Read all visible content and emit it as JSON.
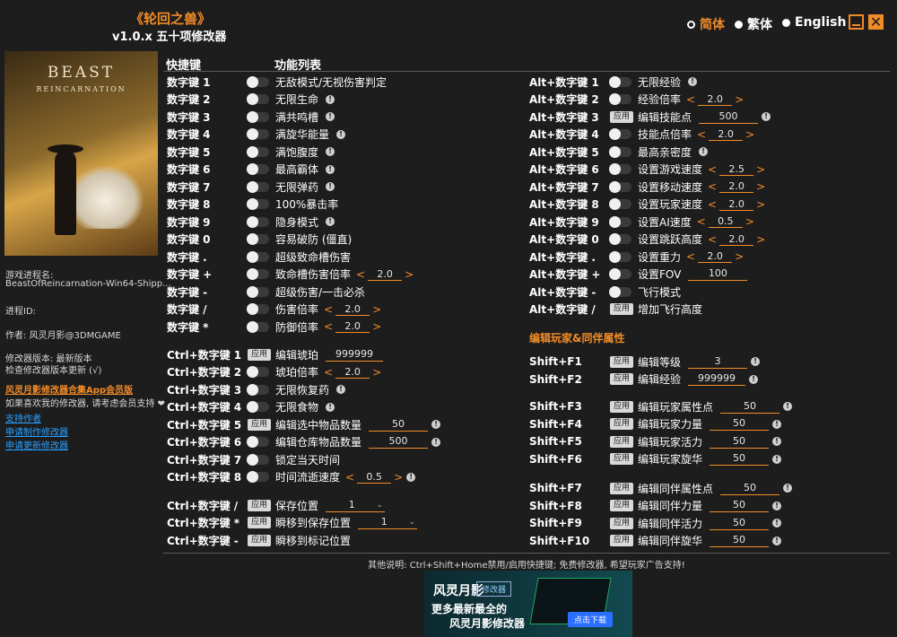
{
  "app": {
    "title": "《轮回之兽》",
    "subtitle": "v1.0.x 五十项修改器"
  },
  "languages": [
    {
      "label": "简体",
      "selected": true
    },
    {
      "label": "繁体",
      "selected": false
    },
    {
      "label": "English",
      "selected": false
    }
  ],
  "cover": {
    "title": "BEAST",
    "subtitle": "REINCARNATION"
  },
  "sidebar": {
    "process_label": "游戏进程名:",
    "process_value": "BeastOfReincarnation-Win64-Shipp...",
    "pid_label": "进程ID:",
    "author": "作者: 风灵月影@3DMGAME",
    "version": "修改器版本: 最新版本",
    "check_update": "检查修改器版本更新 (√)",
    "vip_link": "风灵月影修改器合集App会员版",
    "support_text": "如果喜欢我的修改器, 请考虑会员支持 ❤",
    "support_author": "支持作者",
    "request_make": "申请制作修改器",
    "request_update": "申请更新修改器"
  },
  "headers": {
    "hotkey": "快捷键",
    "features": "功能列表"
  },
  "left_rows": [
    {
      "key": "数字键 1",
      "type": "toggle",
      "label": "无敌模式/无视伤害判定"
    },
    {
      "key": "数字键 2",
      "type": "toggle",
      "label": "无限生命",
      "info": true
    },
    {
      "key": "数字键 3",
      "type": "toggle",
      "label": "满共鸣槽",
      "info": true
    },
    {
      "key": "数字键 4",
      "type": "toggle",
      "label": "满旋华能量",
      "info": true
    },
    {
      "key": "数字键 5",
      "type": "toggle",
      "label": "满饱腹度",
      "info": true
    },
    {
      "key": "数字键 6",
      "type": "toggle",
      "label": "最高霸体",
      "info": true
    },
    {
      "key": "数字键 7",
      "type": "toggle",
      "label": "无限弹药",
      "info": true
    },
    {
      "key": "数字键 8",
      "type": "toggle",
      "label": "100%暴击率"
    },
    {
      "key": "数字键 9",
      "type": "toggle",
      "label": "隐身模式",
      "info": true
    },
    {
      "key": "数字键 0",
      "type": "toggle",
      "label": "容易破防 (僵直)"
    },
    {
      "key": "数字键 .",
      "type": "toggle",
      "label": "超级致命槽伤害"
    },
    {
      "key": "数字键 +",
      "type": "toggle",
      "label": "致命槽伤害倍率",
      "stepper": "2.0"
    },
    {
      "key": "数字键 -",
      "type": "toggle",
      "label": "超级伤害/一击必杀"
    },
    {
      "key": "数字键 /",
      "type": "toggle",
      "label": "伤害倍率",
      "stepper": "2.0"
    },
    {
      "key": "数字键 *",
      "type": "toggle",
      "label": "防御倍率",
      "stepper": "2.0"
    },
    {
      "key": "Ctrl+数字键 1",
      "type": "apply",
      "label": "编辑琥珀",
      "field": "999999"
    },
    {
      "key": "Ctrl+数字键 2",
      "type": "toggle",
      "label": "琥珀倍率",
      "stepper": "2.0"
    },
    {
      "key": "Ctrl+数字键 3",
      "type": "toggle",
      "label": "无限恢复药",
      "info": true
    },
    {
      "key": "Ctrl+数字键 4",
      "type": "toggle",
      "label": "无限食物",
      "info": true
    },
    {
      "key": "Ctrl+数字键 5",
      "type": "apply",
      "label": "编辑选中物品数量",
      "field": "50",
      "info": true
    },
    {
      "key": "Ctrl+数字键 6",
      "type": "toggle",
      "label": "编辑仓库物品数量",
      "field": "500",
      "info": true
    },
    {
      "key": "Ctrl+数字键 7",
      "type": "toggle",
      "label": "锁定当天时间"
    },
    {
      "key": "Ctrl+数字键 8",
      "type": "toggle",
      "label": "时间流逝速度",
      "stepper": "0.5",
      "info": true
    },
    {
      "key": "Ctrl+数字键 /",
      "type": "apply",
      "label": "保存位置",
      "select": "1"
    },
    {
      "key": "Ctrl+数字键 *",
      "type": "apply",
      "label": "瞬移到保存位置",
      "select": "1"
    },
    {
      "key": "Ctrl+数字键 -",
      "type": "apply",
      "label": "瞬移到标记位置"
    }
  ],
  "right_rows": [
    {
      "key": "Alt+数字键 1",
      "type": "toggle",
      "label": "无限经验",
      "info": true
    },
    {
      "key": "Alt+数字键 2",
      "type": "toggle",
      "label": "经验倍率",
      "stepper": "2.0"
    },
    {
      "key": "Alt+数字键 3",
      "type": "apply",
      "label": "编辑技能点",
      "field": "500",
      "info": true
    },
    {
      "key": "Alt+数字键 4",
      "type": "toggle",
      "label": "技能点倍率",
      "stepper": "2.0"
    },
    {
      "key": "Alt+数字键 5",
      "type": "toggle",
      "label": "最高亲密度",
      "info": true
    },
    {
      "key": "Alt+数字键 6",
      "type": "toggle",
      "label": "设置游戏速度",
      "stepper": "2.5"
    },
    {
      "key": "Alt+数字键 7",
      "type": "toggle",
      "label": "设置移动速度",
      "stepper": "2.0"
    },
    {
      "key": "Alt+数字键 8",
      "type": "toggle",
      "label": "设置玩家速度",
      "stepper": "2.0"
    },
    {
      "key": "Alt+数字键 9",
      "type": "toggle",
      "label": "设置AI速度",
      "stepper": "0.5"
    },
    {
      "key": "Alt+数字键 0",
      "type": "toggle",
      "label": "设置跳跃高度",
      "stepper": "2.0"
    },
    {
      "key": "Alt+数字键 .",
      "type": "toggle",
      "label": "设置重力",
      "stepper": "2.0"
    },
    {
      "key": "Alt+数字键 +",
      "type": "toggle",
      "label": "设置FOV",
      "field": "100"
    },
    {
      "key": "Alt+数字键 -",
      "type": "toggle",
      "label": "飞行模式"
    },
    {
      "key": "Alt+数字键 /",
      "type": "apply",
      "label": "增加飞行高度"
    },
    {
      "key": "Shift+F1",
      "type": "apply",
      "label": "编辑等级",
      "field": "3",
      "info": true
    },
    {
      "key": "Shift+F2",
      "type": "apply",
      "label": "编辑经验",
      "field": "999999",
      "info": true
    },
    {
      "key": "Shift+F3",
      "type": "apply",
      "label": "编辑玩家属性点",
      "field": "50",
      "info": true
    },
    {
      "key": "Shift+F4",
      "type": "apply",
      "label": "编辑玩家力量",
      "field": "50",
      "info": true
    },
    {
      "key": "Shift+F5",
      "type": "apply",
      "label": "编辑玩家活力",
      "field": "50",
      "info": true
    },
    {
      "key": "Shift+F6",
      "type": "apply",
      "label": "编辑玩家旋华",
      "field": "50",
      "info": true
    },
    {
      "key": "Shift+F7",
      "type": "apply",
      "label": "编辑同伴属性点",
      "field": "50",
      "info": true
    },
    {
      "key": "Shift+F8",
      "type": "apply",
      "label": "编辑同伴力量",
      "field": "50",
      "info": true
    },
    {
      "key": "Shift+F9",
      "type": "apply",
      "label": "编辑同伴活力",
      "field": "50",
      "info": true
    },
    {
      "key": "Shift+F10",
      "type": "apply",
      "label": "编辑同伴旋华",
      "field": "50",
      "info": true
    }
  ],
  "section_companion": "编辑玩家&同伴属性",
  "apply_label": "应用",
  "stepper_left": "<",
  "stepper_right": ">",
  "info_icon": "!",
  "footer": "其他说明: Ctrl+Shift+Home禁用/启用快捷键; 免费修改器, 希望玩家广告支持!",
  "ad": {
    "logo": "风灵月影",
    "badge": "修改器",
    "line1": "更多最新最全的",
    "line2": "风灵月影修改器",
    "button": "点击下载"
  },
  "colors": {
    "accent": "#f28c28",
    "background": "#1d1d1d",
    "link": "#2aa0ff"
  }
}
